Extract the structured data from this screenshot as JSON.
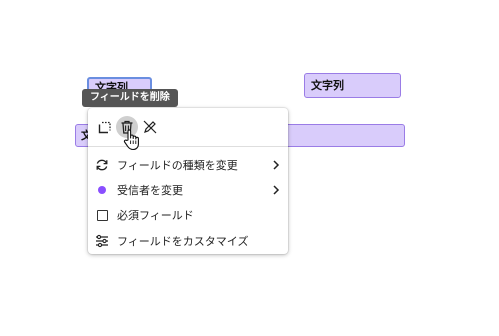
{
  "fields": [
    {
      "label": "文字列"
    },
    {
      "label": "文字列"
    },
    {
      "label": "文字列"
    }
  ],
  "tooltip": {
    "text": "フィールドを削除"
  },
  "toolbar": {
    "icons": [
      "duplicate-icon",
      "trash-icon",
      "unlink-pen-icon"
    ]
  },
  "menu": {
    "items": [
      {
        "label": "フィールドの種類を変更",
        "icon": "refresh-icon",
        "has_submenu": true
      },
      {
        "label": "受信者を変更",
        "icon": "recipient-dot",
        "has_submenu": true
      },
      {
        "label": "必須フィールド",
        "icon": "checkbox",
        "checked": false
      },
      {
        "label": "フィールドをカスタマイズ",
        "icon": "sliders-icon"
      }
    ]
  },
  "colors": {
    "field_fill": "#d9ccfb",
    "field_border": "#9a7ce6",
    "selected_border": "#6a8ee0",
    "recipient": "#8a4fff",
    "tooltip_bg": "#555555"
  }
}
